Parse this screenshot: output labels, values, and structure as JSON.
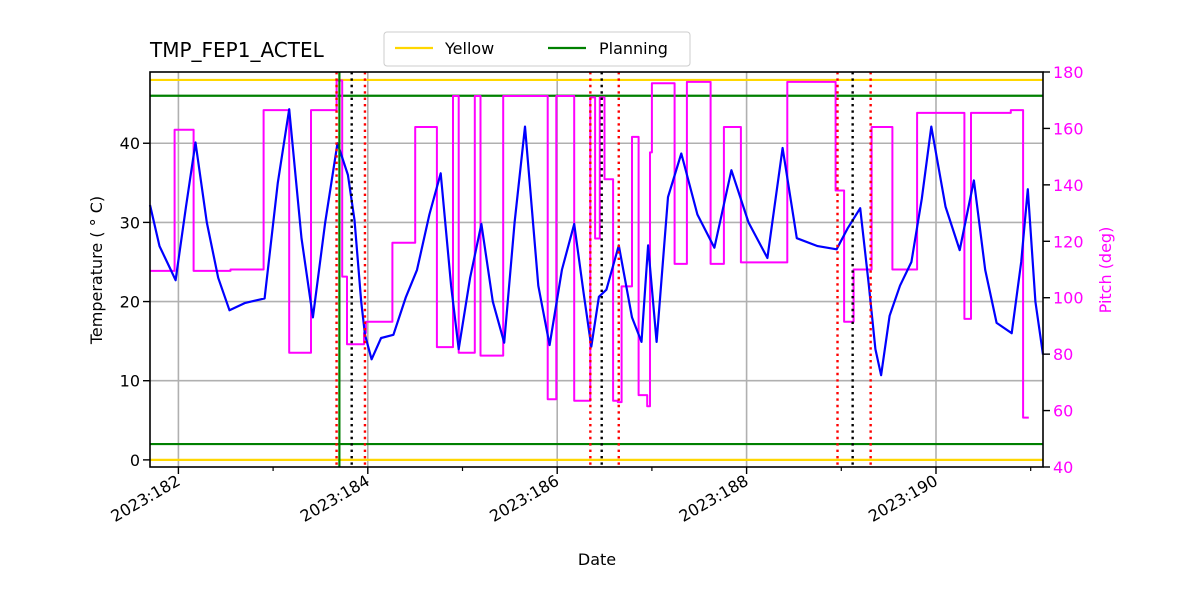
{
  "chart_data": {
    "type": "line",
    "title": "TMP_FEP1_ACTEL",
    "xlabel": "Date",
    "ylabel": "Temperature ($^\\circ$C)",
    "ylabel_display": "Temperature ( ° C)",
    "y2label": "Pitch (deg)",
    "xlim": [
      181.7,
      191.13
    ],
    "ylim": [
      -0.9,
      49.0
    ],
    "y2lim": [
      40,
      180
    ],
    "grid": true,
    "x_ticks": [
      {
        "value": 182,
        "label": "2023:182"
      },
      {
        "value": 184,
        "label": "2023:184"
      },
      {
        "value": 186,
        "label": "2023:186"
      },
      {
        "value": 188,
        "label": "2023:188"
      },
      {
        "value": 190,
        "label": "2023:190"
      }
    ],
    "x_minor_ticks": [
      183,
      185,
      187,
      189,
      191
    ],
    "y_ticks": [
      0,
      10,
      20,
      30,
      40
    ],
    "y2_ticks": [
      40,
      60,
      80,
      100,
      120,
      140,
      160,
      180
    ],
    "legend": {
      "placement": "top-center-outside",
      "entries": [
        {
          "label": "Yellow",
          "color": "#ffd700"
        },
        {
          "label": "Planning",
          "color": "#008000"
        }
      ]
    },
    "limit_lines": [
      {
        "name": "yellow-high",
        "value": 48,
        "color": "#ffd700"
      },
      {
        "name": "yellow-low",
        "value": 0,
        "color": "#ffd700"
      },
      {
        "name": "planning-high",
        "value": 46,
        "color": "#008000"
      },
      {
        "name": "planning-low",
        "value": 2,
        "color": "#008000"
      }
    ],
    "vertical_markers": [
      {
        "day": 183.67,
        "color": "#ff0000",
        "style": "dotted"
      },
      {
        "day": 183.7,
        "color": "#008000",
        "style": "solid"
      },
      {
        "day": 183.83,
        "color": "#000000",
        "style": "dotted"
      },
      {
        "day": 183.97,
        "color": "#ff0000",
        "style": "dotted"
      },
      {
        "day": 186.35,
        "color": "#ff0000",
        "style": "dotted"
      },
      {
        "day": 186.47,
        "color": "#000000",
        "style": "dotted"
      },
      {
        "day": 186.65,
        "color": "#ff0000",
        "style": "dotted"
      },
      {
        "day": 188.96,
        "color": "#ff0000",
        "style": "dotted"
      },
      {
        "day": 189.12,
        "color": "#000000",
        "style": "dotted"
      },
      {
        "day": 189.31,
        "color": "#ff0000",
        "style": "dotted"
      }
    ],
    "series": [
      {
        "name": "Temperature",
        "axis": "left",
        "color": "#0000ff",
        "x": [
          181.7,
          181.8,
          181.9,
          181.97,
          182.08,
          182.18,
          182.3,
          182.42,
          182.54,
          182.7,
          182.91,
          183.05,
          183.17,
          183.3,
          183.42,
          183.55,
          183.68,
          183.79,
          183.86,
          183.93,
          183.97,
          184.04,
          184.14,
          184.27,
          184.4,
          184.52,
          184.65,
          184.77,
          184.88,
          184.96,
          185.08,
          185.2,
          185.32,
          185.44,
          185.55,
          185.66,
          185.8,
          185.92,
          186.05,
          186.18,
          186.28,
          186.36,
          186.44,
          186.52,
          186.65,
          186.79,
          186.89,
          186.96,
          187.05,
          187.17,
          187.31,
          187.48,
          187.66,
          187.84,
          188.02,
          188.22,
          188.38,
          188.53,
          188.75,
          188.95,
          189.07,
          189.2,
          189.29,
          189.36,
          189.42,
          189.51,
          189.62,
          189.74,
          189.85,
          189.95,
          190.1,
          190.25,
          190.4,
          190.52,
          190.64,
          190.8,
          190.9,
          190.97,
          191.05,
          191.13
        ],
        "y": [
          32.2,
          27.0,
          24.5,
          22.7,
          32.0,
          40.1,
          30.0,
          23.0,
          18.9,
          19.8,
          20.4,
          35.0,
          44.3,
          28.0,
          18.0,
          30.0,
          40.0,
          36.0,
          30.3,
          20.0,
          15.8,
          12.7,
          15.4,
          15.8,
          20.5,
          24.0,
          31.0,
          36.2,
          22.0,
          14.0,
          23.0,
          29.8,
          20.0,
          14.8,
          30.0,
          42.1,
          22.0,
          14.5,
          24.0,
          29.8,
          21.0,
          14.3,
          20.6,
          21.5,
          27.1,
          18.0,
          14.9,
          27.1,
          14.9,
          33.2,
          38.7,
          31.0,
          26.8,
          36.6,
          30.0,
          25.5,
          39.4,
          28.0,
          27.0,
          26.6,
          29.3,
          31.8,
          22.1,
          14.0,
          10.7,
          18.2,
          22.0,
          25.0,
          33.0,
          42.1,
          32.0,
          26.5,
          35.3,
          24.0,
          17.3,
          16.0,
          25.0,
          34.2,
          20.0,
          13.3
        ]
      },
      {
        "name": "Pitch",
        "axis": "right",
        "color": "#ff00ff",
        "x": [
          181.7,
          181.96,
          181.96,
          182.16,
          182.16,
          182.55,
          182.55,
          182.9,
          182.9,
          183.17,
          183.17,
          183.4,
          183.4,
          183.67,
          183.67,
          183.73,
          183.73,
          183.78,
          183.78,
          183.84,
          183.84,
          183.96,
          183.96,
          183.98,
          183.98,
          184.26,
          184.26,
          184.5,
          184.5,
          184.73,
          184.73,
          184.9,
          184.9,
          184.96,
          184.96,
          185.13,
          185.13,
          185.19,
          185.19,
          185.43,
          185.43,
          185.65,
          185.65,
          185.9,
          185.9,
          185.99,
          185.99,
          186.18,
          186.18,
          186.35,
          186.35,
          186.4,
          186.4,
          186.45,
          186.45,
          186.5,
          186.5,
          186.59,
          186.59,
          186.64,
          186.64,
          186.68,
          186.68,
          186.79,
          186.79,
          186.86,
          186.86,
          186.95,
          186.95,
          186.98,
          186.98,
          187.0,
          187.0,
          187.12,
          187.12,
          187.24,
          187.24,
          187.37,
          187.37,
          187.62,
          187.62,
          187.76,
          187.76,
          187.94,
          187.94,
          188.27,
          188.27,
          188.43,
          188.43,
          188.94,
          188.94,
          189.03,
          189.03,
          189.13,
          189.13,
          189.32,
          189.32,
          189.54,
          189.54,
          189.8,
          189.8,
          190.3,
          190.3,
          190.37,
          190.37,
          190.79,
          190.79,
          190.92,
          190.92,
          190.98,
          190.98,
          191.13
        ],
        "y": [
          109.5,
          109.5,
          159.5,
          159.5,
          109.5,
          109.5,
          110,
          110,
          166.5,
          166.5,
          80.5,
          80.5,
          166.5,
          166.5,
          177.0,
          177.0,
          107.5,
          107.5,
          83.5,
          83.5,
          83.5,
          83.5,
          87.5,
          87.5,
          91.5,
          91.5,
          119.5,
          119.5,
          160.5,
          160.5,
          82.5,
          82.5,
          171.5,
          171.5,
          80.5,
          80.5,
          171.5,
          171.5,
          79.5,
          79.5,
          171.5,
          171.5,
          171.5,
          171.5,
          64.0,
          64.0,
          171.5,
          171.5,
          63.5,
          63.5,
          171.0,
          171.0,
          121.0,
          121.0,
          171.0,
          171.0,
          142.0,
          142.0,
          63.5,
          63.5,
          63.0,
          63.0,
          104.0,
          104.0,
          157.0,
          157.0,
          65.5,
          65.5,
          61.5,
          61.5,
          151.5,
          151.5,
          176.0,
          176.0,
          176.0,
          176.0,
          112.0,
          112.0,
          176.5,
          176.5,
          112.0,
          112.0,
          160.5,
          160.5,
          112.5,
          112.5,
          112.5,
          112.5,
          176.5,
          176.5,
          138.0,
          138.0,
          91.5,
          91.5,
          110.0,
          110.0,
          160.5,
          160.5,
          110.0,
          110.0,
          165.5,
          165.5,
          92.5,
          92.5,
          165.5,
          165.5,
          166.5,
          166.5,
          57.5,
          57.5
        ]
      }
    ]
  }
}
